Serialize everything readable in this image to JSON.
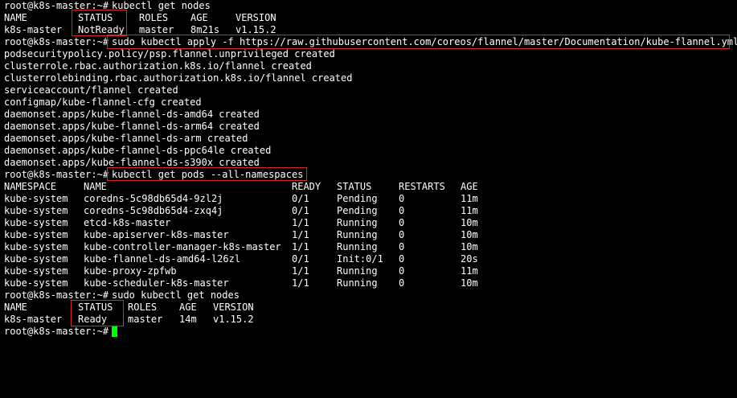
{
  "colors": {
    "background": "#000000",
    "text": "#ffffff",
    "highlight": "#d9262b",
    "cursor": "#00ff00"
  },
  "prompt": "root@k8s-master:~# ",
  "cmd1": "kubectl get nodes",
  "nodes1": {
    "headers": [
      "NAME",
      "STATUS",
      "ROLES",
      "AGE",
      "VERSION"
    ],
    "row": [
      "k8s-master",
      "NotReady",
      "master",
      "8m21s",
      "v1.15.2"
    ]
  },
  "cmd2": "sudo kubectl apply -f https://raw.githubusercontent.com/coreos/flannel/master/Documentation/kube-flannel.yml",
  "apply_output": [
    "podsecuritypolicy.policy/psp.flannel.unprivileged created",
    "clusterrole.rbac.authorization.k8s.io/flannel created",
    "clusterrolebinding.rbac.authorization.k8s.io/flannel created",
    "serviceaccount/flannel created",
    "configmap/kube-flannel-cfg created",
    "daemonset.apps/kube-flannel-ds-amd64 created",
    "daemonset.apps/kube-flannel-ds-arm64 created",
    "daemonset.apps/kube-flannel-ds-arm created",
    "daemonset.apps/kube-flannel-ds-ppc64le created",
    "daemonset.apps/kube-flannel-ds-s390x created"
  ],
  "cmd3": "kubectl get pods --all-namespaces",
  "pods": {
    "headers": [
      "NAMESPACE",
      "NAME",
      "READY",
      "STATUS",
      "RESTARTS",
      "AGE"
    ],
    "rows": [
      [
        "kube-system",
        "coredns-5c98db65d4-9zl2j",
        "0/1",
        "Pending",
        "0",
        "11m"
      ],
      [
        "kube-system",
        "coredns-5c98db65d4-zxq4j",
        "0/1",
        "Pending",
        "0",
        "11m"
      ],
      [
        "kube-system",
        "etcd-k8s-master",
        "1/1",
        "Running",
        "0",
        "10m"
      ],
      [
        "kube-system",
        "kube-apiserver-k8s-master",
        "1/1",
        "Running",
        "0",
        "10m"
      ],
      [
        "kube-system",
        "kube-controller-manager-k8s-master",
        "1/1",
        "Running",
        "0",
        "10m"
      ],
      [
        "kube-system",
        "kube-flannel-ds-amd64-l26zl",
        "0/1",
        "Init:0/1",
        "0",
        "20s"
      ],
      [
        "kube-system",
        "kube-proxy-zpfwb",
        "1/1",
        "Running",
        "0",
        "11m"
      ],
      [
        "kube-system",
        "kube-scheduler-k8s-master",
        "1/1",
        "Running",
        "0",
        "10m"
      ]
    ]
  },
  "cmd4": "sudo kubectl get nodes",
  "nodes2": {
    "headers": [
      "NAME",
      "STATUS",
      "ROLES",
      "AGE",
      "VERSION"
    ],
    "row": [
      "k8s-master",
      "Ready",
      "master",
      "14m",
      "v1.15.2"
    ]
  }
}
